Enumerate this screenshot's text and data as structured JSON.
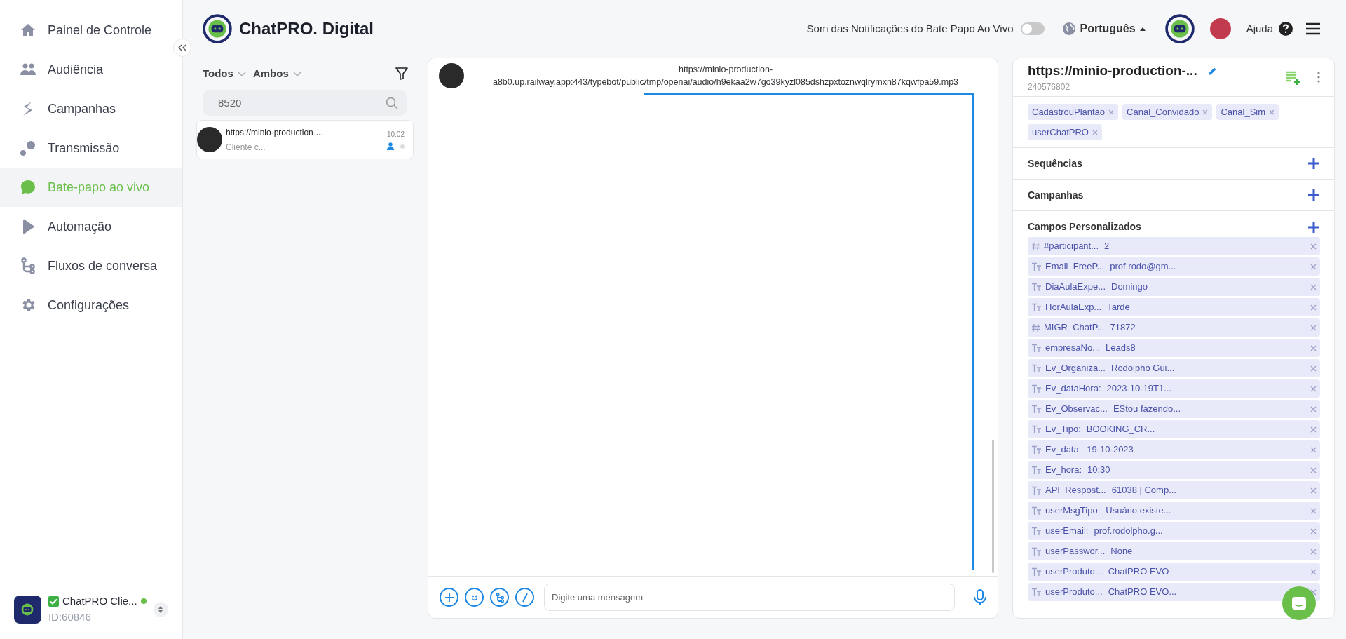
{
  "sidebar": {
    "items": [
      {
        "label": "Painel de Controle",
        "selected": false
      },
      {
        "label": "Audiência",
        "selected": false
      },
      {
        "label": "Campanhas",
        "selected": false
      },
      {
        "label": "Transmissão",
        "selected": false
      },
      {
        "label": "Bate-papo ao vivo",
        "selected": true
      },
      {
        "label": "Automação",
        "selected": false
      },
      {
        "label": "Fluxos de conversa",
        "selected": false
      },
      {
        "label": "Configurações",
        "selected": false
      }
    ],
    "account": {
      "name": "ChatPRO Clie...",
      "id": "ID:60846",
      "online": true
    }
  },
  "header": {
    "brand": "ChatPRO. Digital",
    "notification_label": "Som das Notificações do Bate Papo Ao Vivo",
    "notification_on": false,
    "language": "Português",
    "help": "Ajuda"
  },
  "chat_list": {
    "filters": [
      "Todos",
      "Ambos"
    ],
    "search_value": "8520",
    "items": [
      {
        "title": "https://minio-production-...",
        "preview": "Cliente c...",
        "time": "10:02",
        "selected": false
      }
    ]
  },
  "conversation": {
    "title": "https://minio-production-a8b0.up.railway.app:443/typebot/public/tmp/openai/audio/h9ekaa2w7go39kyzl085dshzpxtoznwqlrymxn87kqwfpa59.mp3",
    "input_placeholder": "Digite uma mensagem"
  },
  "contact": {
    "name": "https://minio-production-...",
    "id": "240576802",
    "tags": [
      "CadastrouPlantao",
      "Canal_Convidado",
      "Canal_Sim",
      "userChatPRO"
    ],
    "sections": [
      "Sequências",
      "Campanhas",
      "Campos Personalizados"
    ],
    "fields": [
      {
        "kind": "number",
        "key": "#participant...",
        "value": "2"
      },
      {
        "kind": "text",
        "key": "Email_FreeP...",
        "value": "prof.rodo@gm..."
      },
      {
        "kind": "text",
        "key": "DiaAulaExpe...",
        "value": "Domingo"
      },
      {
        "kind": "text",
        "key": "HorAulaExp...",
        "value": "Tarde"
      },
      {
        "kind": "number",
        "key": "MIGR_ChatP...",
        "value": "71872"
      },
      {
        "kind": "text",
        "key": "empresaNo...",
        "value": "Leads8"
      },
      {
        "kind": "text",
        "key": "Ev_Organiza...",
        "value": "Rodolpho Gui..."
      },
      {
        "kind": "text",
        "key": "Ev_dataHora:",
        "value": "2023-10-19T1..."
      },
      {
        "kind": "text",
        "key": "Ev_Observac...",
        "value": "EStou fazendo..."
      },
      {
        "kind": "text",
        "key": "Ev_Tipo:",
        "value": "BOOKING_CR..."
      },
      {
        "kind": "text",
        "key": "Ev_data:",
        "value": "19-10-2023"
      },
      {
        "kind": "text",
        "key": "Ev_hora:",
        "value": "10:30"
      },
      {
        "kind": "text",
        "key": "API_Respost...",
        "value": "61038 | Comp..."
      },
      {
        "kind": "text",
        "key": "userMsgTipo:",
        "value": "Usuário existe..."
      },
      {
        "kind": "text",
        "key": "userEmail:",
        "value": "prof.rodolpho.g..."
      },
      {
        "kind": "text",
        "key": "userPasswor...",
        "value": "None"
      },
      {
        "kind": "text",
        "key": "userProduto...",
        "value": "ChatPRO EVO"
      },
      {
        "kind": "text",
        "key": "userProduto...",
        "value": "ChatPRO EVO..."
      }
    ]
  }
}
